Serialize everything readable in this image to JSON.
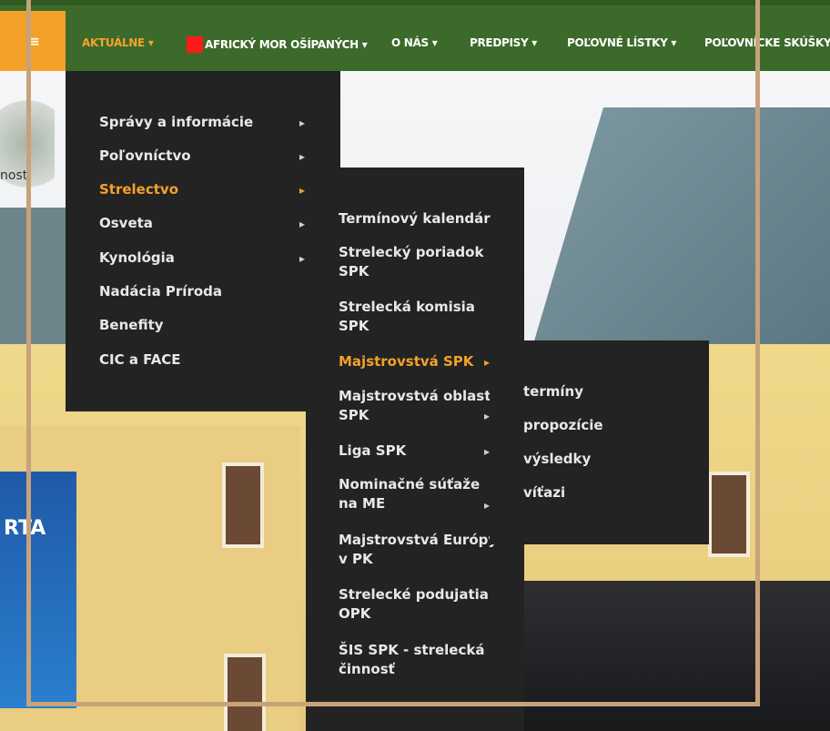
{
  "nav": {
    "items": [
      {
        "label": "AKTUÁLNE",
        "active": true
      },
      {
        "label": "AFRICKÝ MOR OŠÍPANÝCH",
        "active": false
      },
      {
        "label": "O NÁS",
        "active": false
      },
      {
        "label": "PREDPISY",
        "active": false
      },
      {
        "label": "POĽOVNÉ LÍSTKY",
        "active": false
      },
      {
        "label": "POĽOVNÍCKE SKÚŠKY",
        "active": false
      }
    ],
    "accent_color": "#f4a12a",
    "bar_color": "#3b6a2a",
    "alert_square_color": "#ff1a1a"
  },
  "menu_level1": [
    {
      "label": "Správy a informácie",
      "has_sub": true
    },
    {
      "label": "Poľovníctvo",
      "has_sub": true
    },
    {
      "label": "Strelectvo",
      "has_sub": true,
      "active": true
    },
    {
      "label": "Osveta",
      "has_sub": true
    },
    {
      "label": "Kynológia",
      "has_sub": true
    },
    {
      "label": "Nadácia Príroda",
      "has_sub": false
    },
    {
      "label": "Benefity",
      "has_sub": false
    },
    {
      "label": "CIC a FACE",
      "has_sub": false
    }
  ],
  "menu_level2": [
    {
      "label1": "Termínový kalendár",
      "label2": ""
    },
    {
      "label1": "Strelecký poriadok",
      "label2": "SPK"
    },
    {
      "label1": "Strelecká komisia",
      "label2": "SPK"
    },
    {
      "label1": "Majstrovstvá SPK",
      "label2": "",
      "active": true,
      "has_sub": true
    },
    {
      "label1": "Majstrovstvá oblasti",
      "label2": "SPK",
      "has_sub": true
    },
    {
      "label1": "Liga SPK",
      "label2": "",
      "has_sub": true
    },
    {
      "label1": "Nominačné súťaže",
      "label2": "na ME",
      "has_sub": true
    },
    {
      "label1": "Majstrovstvá Európy",
      "label2": "v PK"
    },
    {
      "label1": "Strelecké podujatia",
      "label2": "OPK"
    },
    {
      "label1": "ŠIS SPK - strelecká",
      "label2": "činnosť"
    }
  ],
  "menu_level3": [
    {
      "label": "termíny"
    },
    {
      "label": "propozície"
    },
    {
      "label": "výsledky"
    },
    {
      "label": "víťazi"
    }
  ],
  "background_text": {
    "left_fragment": "nosti",
    "banner_text": "RTA"
  }
}
